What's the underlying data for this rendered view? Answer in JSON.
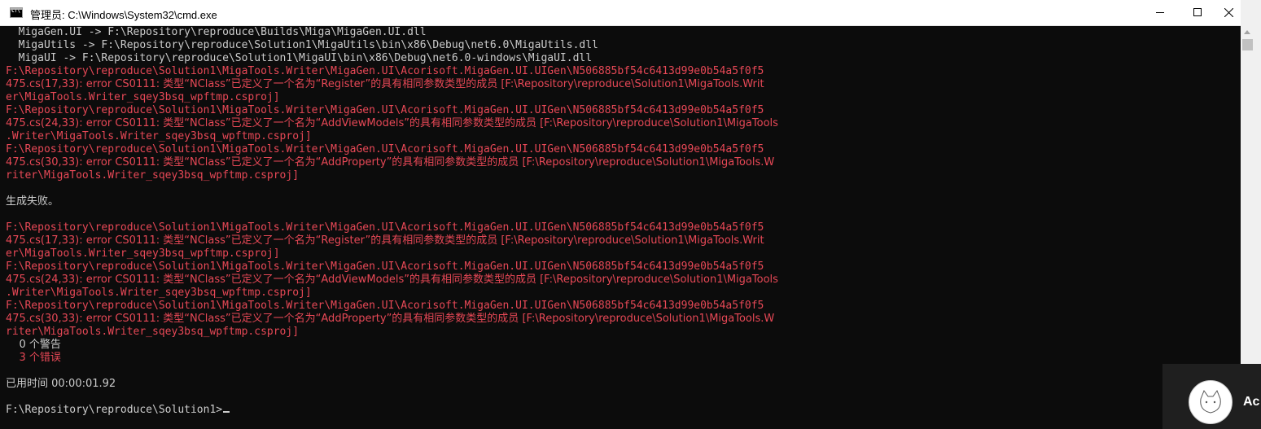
{
  "window": {
    "title": "管理员: C:\\Windows\\System32\\cmd.exe",
    "icon": "cmd-icon",
    "controls": [
      "minimize-icon",
      "maximize-icon",
      "close-icon"
    ]
  },
  "console": {
    "lines": [
      {
        "text": "  MigaGen.UI -> F:\\Repository\\reproduce\\Builds\\Miga\\MigaGen.UI.dll",
        "kind": "normal"
      },
      {
        "text": "  MigaUtils -> F:\\Repository\\reproduce\\Solution1\\MigaUtils\\bin\\x86\\Debug\\net6.0\\MigaUtils.dll",
        "kind": "normal"
      },
      {
        "text": "  MigaUI -> F:\\Repository\\reproduce\\Solution1\\MigaUI\\bin\\x86\\Debug\\net6.0-windows\\MigaUI.dll",
        "kind": "normal"
      },
      {
        "text": "F:\\Repository\\reproduce\\Solution1\\MigaTools.Writer\\MigaGen.UI\\Acorisoft.MigaGen.UI.UIGen\\N506885bf54c6413d99e0b54a5f0f5",
        "kind": "error"
      },
      {
        "text": "475.cs(17,33): error CS0111: 类型“NClass”已定义了一个名为“Register”的具有相同参数类型的成员 [F:\\Repository\\reproduce\\Solution1\\MigaTools.Writ",
        "kind": "error"
      },
      {
        "text": "er\\MigaTools.Writer_sqey3bsq_wpftmp.csproj]",
        "kind": "error"
      },
      {
        "text": "F:\\Repository\\reproduce\\Solution1\\MigaTools.Writer\\MigaGen.UI\\Acorisoft.MigaGen.UI.UIGen\\N506885bf54c6413d99e0b54a5f0f5",
        "kind": "error"
      },
      {
        "text": "475.cs(24,33): error CS0111: 类型“NClass”已定义了一个名为“AddViewModels”的具有相同参数类型的成员 [F:\\Repository\\reproduce\\Solution1\\MigaTools",
        "kind": "error"
      },
      {
        "text": ".Writer\\MigaTools.Writer_sqey3bsq_wpftmp.csproj]",
        "kind": "error"
      },
      {
        "text": "F:\\Repository\\reproduce\\Solution1\\MigaTools.Writer\\MigaGen.UI\\Acorisoft.MigaGen.UI.UIGen\\N506885bf54c6413d99e0b54a5f0f5",
        "kind": "error"
      },
      {
        "text": "475.cs(30,33): error CS0111: 类型“NClass”已定义了一个名为“AddProperty”的具有相同参数类型的成员 [F:\\Repository\\reproduce\\Solution1\\MigaTools.W",
        "kind": "error"
      },
      {
        "text": "riter\\MigaTools.Writer_sqey3bsq_wpftmp.csproj]",
        "kind": "error"
      },
      {
        "text": "",
        "kind": "normal"
      },
      {
        "text": "生成失败。",
        "kind": "normal"
      },
      {
        "text": "",
        "kind": "normal"
      },
      {
        "text": "F:\\Repository\\reproduce\\Solution1\\MigaTools.Writer\\MigaGen.UI\\Acorisoft.MigaGen.UI.UIGen\\N506885bf54c6413d99e0b54a5f0f5",
        "kind": "error"
      },
      {
        "text": "475.cs(17,33): error CS0111: 类型“NClass”已定义了一个名为“Register”的具有相同参数类型的成员 [F:\\Repository\\reproduce\\Solution1\\MigaTools.Writ",
        "kind": "error"
      },
      {
        "text": "er\\MigaTools.Writer_sqey3bsq_wpftmp.csproj]",
        "kind": "error"
      },
      {
        "text": "F:\\Repository\\reproduce\\Solution1\\MigaTools.Writer\\MigaGen.UI\\Acorisoft.MigaGen.UI.UIGen\\N506885bf54c6413d99e0b54a5f0f5",
        "kind": "error"
      },
      {
        "text": "475.cs(24,33): error CS0111: 类型“NClass”已定义了一个名为“AddViewModels”的具有相同参数类型的成员 [F:\\Repository\\reproduce\\Solution1\\MigaTools",
        "kind": "error"
      },
      {
        "text": ".Writer\\MigaTools.Writer_sqey3bsq_wpftmp.csproj]",
        "kind": "error"
      },
      {
        "text": "F:\\Repository\\reproduce\\Solution1\\MigaTools.Writer\\MigaGen.UI\\Acorisoft.MigaGen.UI.UIGen\\N506885bf54c6413d99e0b54a5f0f5",
        "kind": "error"
      },
      {
        "text": "475.cs(30,33): error CS0111: 类型“NClass”已定义了一个名为“AddProperty”的具有相同参数类型的成员 [F:\\Repository\\reproduce\\Solution1\\MigaTools.W",
        "kind": "error"
      },
      {
        "text": "riter\\MigaTools.Writer_sqey3bsq_wpftmp.csproj]",
        "kind": "error"
      },
      {
        "text": "    0 个警告",
        "kind": "normal"
      },
      {
        "text": "    3 个错误",
        "kind": "error"
      },
      {
        "text": "",
        "kind": "normal"
      },
      {
        "text": "已用时间 00:00:01.92",
        "kind": "normal"
      },
      {
        "text": "",
        "kind": "normal"
      },
      {
        "text": "F:\\Repository\\reproduce\\Solution1>",
        "kind": "prompt"
      }
    ]
  },
  "colors": {
    "console_background": "#0c0c0c",
    "console_text": "#cccccc",
    "error_text": "#e74856"
  },
  "notification": {
    "text": "Ac",
    "avatar": "avatar-icon"
  }
}
